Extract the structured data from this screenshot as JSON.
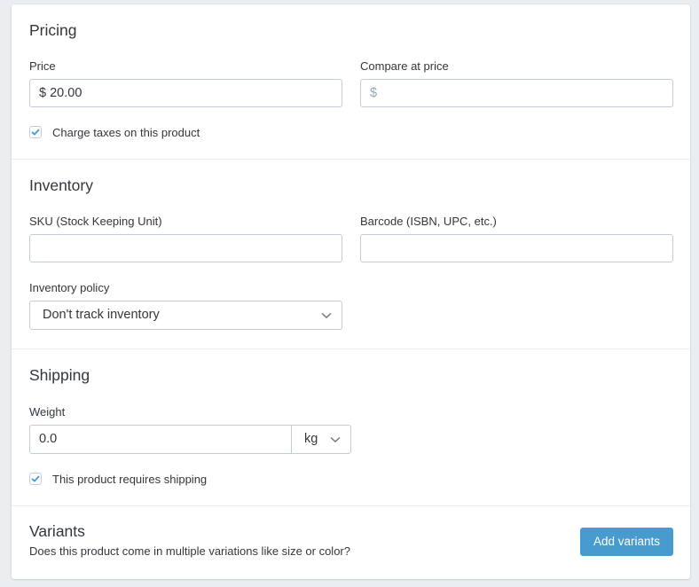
{
  "pricing": {
    "title": "Pricing",
    "price_label": "Price",
    "price_value": "$ 20.00",
    "compare_label": "Compare at price",
    "compare_placeholder": "$",
    "charge_taxes_label": "Charge taxes on this product",
    "charge_taxes_checked": true
  },
  "inventory": {
    "title": "Inventory",
    "sku_label": "SKU (Stock Keeping Unit)",
    "sku_value": "",
    "barcode_label": "Barcode (ISBN, UPC, etc.)",
    "barcode_value": "",
    "policy_label": "Inventory policy",
    "policy_selected": "Don't track inventory"
  },
  "shipping": {
    "title": "Shipping",
    "weight_label": "Weight",
    "weight_value": "0.0",
    "weight_unit": "kg",
    "requires_shipping_label": "This product requires shipping",
    "requires_shipping_checked": true
  },
  "variants": {
    "title": "Variants",
    "description": "Does this product come in multiple variations like size or color?",
    "add_button_label": "Add variants"
  },
  "colors": {
    "accent": "#479ccf",
    "page_background": "#ebeef0",
    "text": "#31373d",
    "border": "#c4cdd5"
  }
}
